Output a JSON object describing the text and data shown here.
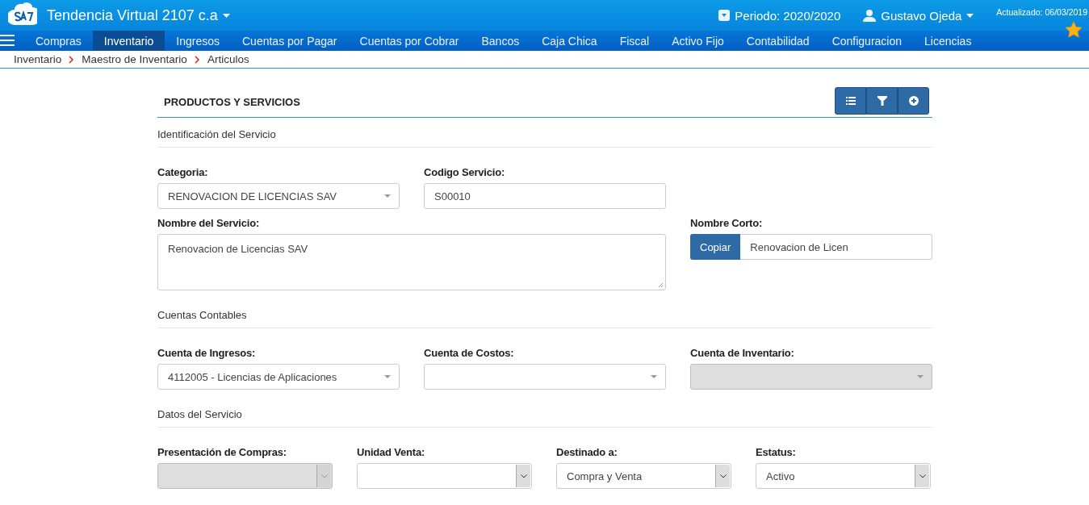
{
  "header": {
    "company": "Tendencia Virtual 2107 c.a",
    "period": "Periodo: 2020/2020",
    "user": "Gustavo Ojeda",
    "updated": "Actualizado: 06/03/2019"
  },
  "menu": [
    {
      "label": "Compras",
      "selected": false
    },
    {
      "label": "Inventario",
      "selected": true
    },
    {
      "label": "Ingresos",
      "selected": false
    },
    {
      "label": "Cuentas por Pagar",
      "selected": false
    },
    {
      "label": "Cuentas por Cobrar",
      "selected": false
    },
    {
      "label": "Bancos",
      "selected": false
    },
    {
      "label": "Caja Chica",
      "selected": false
    },
    {
      "label": "Fiscal",
      "selected": false
    },
    {
      "label": "Activo Fijo",
      "selected": false
    },
    {
      "label": "Contabilidad",
      "selected": false
    },
    {
      "label": "Configuracion",
      "selected": false
    },
    {
      "label": "Licencias",
      "selected": false
    }
  ],
  "breadcrumb": [
    "Inventario",
    "Maestro de Inventario",
    "Articulos"
  ],
  "panel": {
    "title": "PRODUCTOS Y SERVICIOS",
    "sections": [
      {
        "title": "Identificación del Servicio",
        "rows": [
          [
            {
              "kind": "select",
              "label": "Categoria:",
              "value": "RENOVACION DE LICENCIAS SAV",
              "disabled": false
            },
            {
              "kind": "text",
              "label": "Codigo Servicio:",
              "value": "S00010"
            }
          ],
          [
            {
              "kind": "textarea",
              "label": "Nombre del Servicio:",
              "value": "Renovacion de Licencias SAV"
            },
            {
              "kind": "copy",
              "label": "Nombre Corto:",
              "button": "Copiar",
              "value": "Renovacion de Licen"
            }
          ]
        ]
      },
      {
        "title": "Cuentas Contables",
        "rows": [
          [
            {
              "kind": "select",
              "label": "Cuenta de Ingresos:",
              "value": "4112005 - Licencias de Aplicaciones",
              "disabled": false
            },
            {
              "kind": "select",
              "label": "Cuenta de Costos:",
              "disabled": false
            },
            {
              "kind": "select",
              "label": "Cuenta de Inventario:",
              "disabled": true
            }
          ]
        ]
      },
      {
        "title": "Datos del Servicio",
        "rows": [
          [
            {
              "kind": "native-select",
              "label": "Presentación de Compras:",
              "disabled": true
            },
            {
              "kind": "native-select",
              "label": "Unidad Venta:",
              "disabled": false
            },
            {
              "kind": "native-select",
              "label": "Destinado a:",
              "value": "Compra y Venta",
              "disabled": false
            },
            {
              "kind": "native-select",
              "label": "Estatus:",
              "value": "Activo",
              "disabled": false
            }
          ]
        ]
      }
    ]
  }
}
